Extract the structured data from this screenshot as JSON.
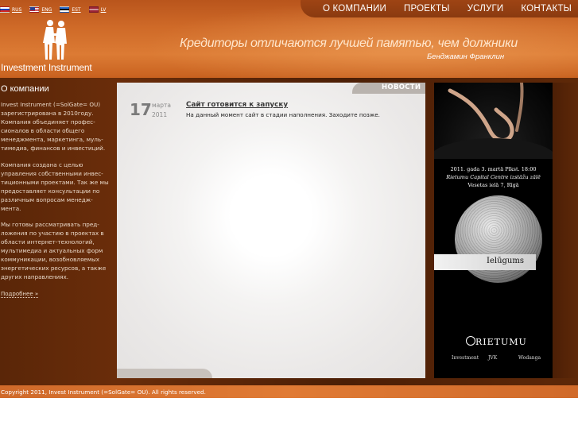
{
  "header": {
    "languages": [
      {
        "code": "RUS",
        "flag": "ru-flag-icon"
      },
      {
        "code": "ENG",
        "flag": "us-flag-icon"
      },
      {
        "code": "EST",
        "flag": "ee-flag-icon"
      },
      {
        "code": "LV",
        "flag": "lv-flag-icon"
      }
    ],
    "logo_text": "Investment Instrument",
    "nav": [
      "О КОМПАНИИ",
      "ПРОЕКТЫ",
      "УСЛУГИ",
      "КОНТАКТЫ"
    ],
    "quote": "Кредиторы отличаются лучшей памятью, чем должники",
    "quote_author": "Бенджамин Франклин"
  },
  "sidebar": {
    "title": "О компании",
    "paragraphs": [
      "Invest Instrument (=SolGate= OU) зарегистрирована в 2010году. Компания объединяет профес-сионалов в области общего менеджмента, маркетинга, муль-тимедиа, финансов и инвестиций.",
      "Компания создана с целью управления собственными инвес-тиционными проектами. Так же мы предоставляет консультации по различным вопросам менедж-мента.",
      "Мы готовы рассматривать пред-ложения по участию в проектах в области интернет-технологий, мультимедиа и актуальных форм коммуникации, возобновляемых энергетических ресурсов, а также других направлениях."
    ],
    "more_link": "Подробнее »"
  },
  "news": {
    "tab_label": "НОВОСТИ",
    "items": [
      {
        "day": "17",
        "month": "марта",
        "year": "2011",
        "title": "Сайт готовится к запуску",
        "text": "На данный момент сайт в стадии наполнения. Заходите позже."
      }
    ]
  },
  "poster": {
    "line1": "2011. gada 3. martā Plkst. 18:00",
    "line2": "Rietumu Capital Centre izstāžu zālē",
    "line3": "Vesetas ielā 7, Rīgā",
    "invite": "Ielūgums",
    "brand": "RIETUMU",
    "sponsors": [
      "Investment",
      "JVK",
      "Wodanga"
    ]
  },
  "footer": {
    "copyright": "Copyright 2011, Invest Instrument (=SolGate= OU). All rights reserved."
  },
  "colors": {
    "header_orange": "#d06a2a",
    "body_brown": "#5a2608",
    "footer_orange": "#e07b35"
  }
}
